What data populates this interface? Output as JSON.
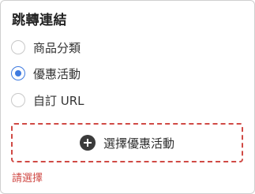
{
  "title": "跳轉連結",
  "options": [
    {
      "label": "商品分類",
      "checked": false
    },
    {
      "label": "優惠活動",
      "checked": true
    },
    {
      "label": "自訂 URL",
      "checked": false
    }
  ],
  "select_button": {
    "icon": "plus-circle-icon",
    "label": "選擇優惠活動"
  },
  "error_text": "請選擇",
  "colors": {
    "accent": "#3f7be0",
    "error": "#d04a45",
    "border": "#cfcfcf",
    "icon": "#3b3b3b"
  }
}
